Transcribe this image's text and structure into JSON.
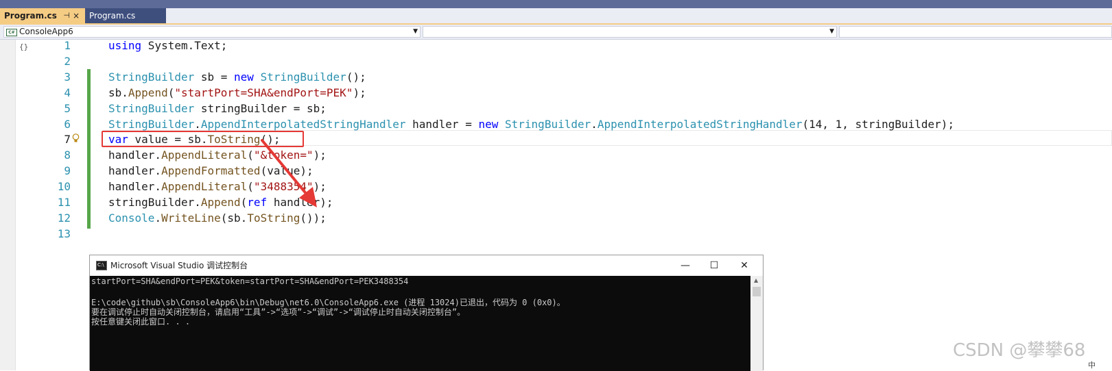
{
  "tabs": [
    {
      "label": "Program.cs",
      "active": true,
      "pin": "⊣",
      "close": "×"
    },
    {
      "label": "Program.cs",
      "active": false
    }
  ],
  "navbar": {
    "project": "ConsoleApp6",
    "project_icon": "C#",
    "member": "",
    "extra": ""
  },
  "editor": {
    "collapse_icon": "{}",
    "line_numbers": [
      "1",
      "2",
      "3",
      "4",
      "5",
      "6",
      "7",
      "8",
      "9",
      "10",
      "11",
      "12",
      "13"
    ]
  },
  "console": {
    "title": "Microsoft Visual Studio 调试控制台",
    "buttons": {
      "minimize": "—",
      "maximize": "☐",
      "close": "✕"
    },
    "lines": [
      "startPort=SHA&endPort=PEK&token=startPort=SHA&endPort=PEK3488354",
      "",
      "E:\\code\\github\\sb\\ConsoleApp6\\bin\\Debug\\net6.0\\ConsoleApp6.exe (进程 13024)已退出，代码为 0 (0x0)。",
      "要在调试停止时自动关闭控制台，请启用“工具”->“选项”->“调试”->“调试停止时自动关闭控制台”。",
      "按任意键关闭此窗口. . ."
    ]
  },
  "watermark": "CSDN @攀攀68",
  "corner_text": "中",
  "colors": {
    "keyword": "#0000ff",
    "type": "#2b91af",
    "method": "#74531f",
    "string": "#a31515",
    "highlight_box": "#e53935",
    "change_bar": "#57a64a"
  }
}
